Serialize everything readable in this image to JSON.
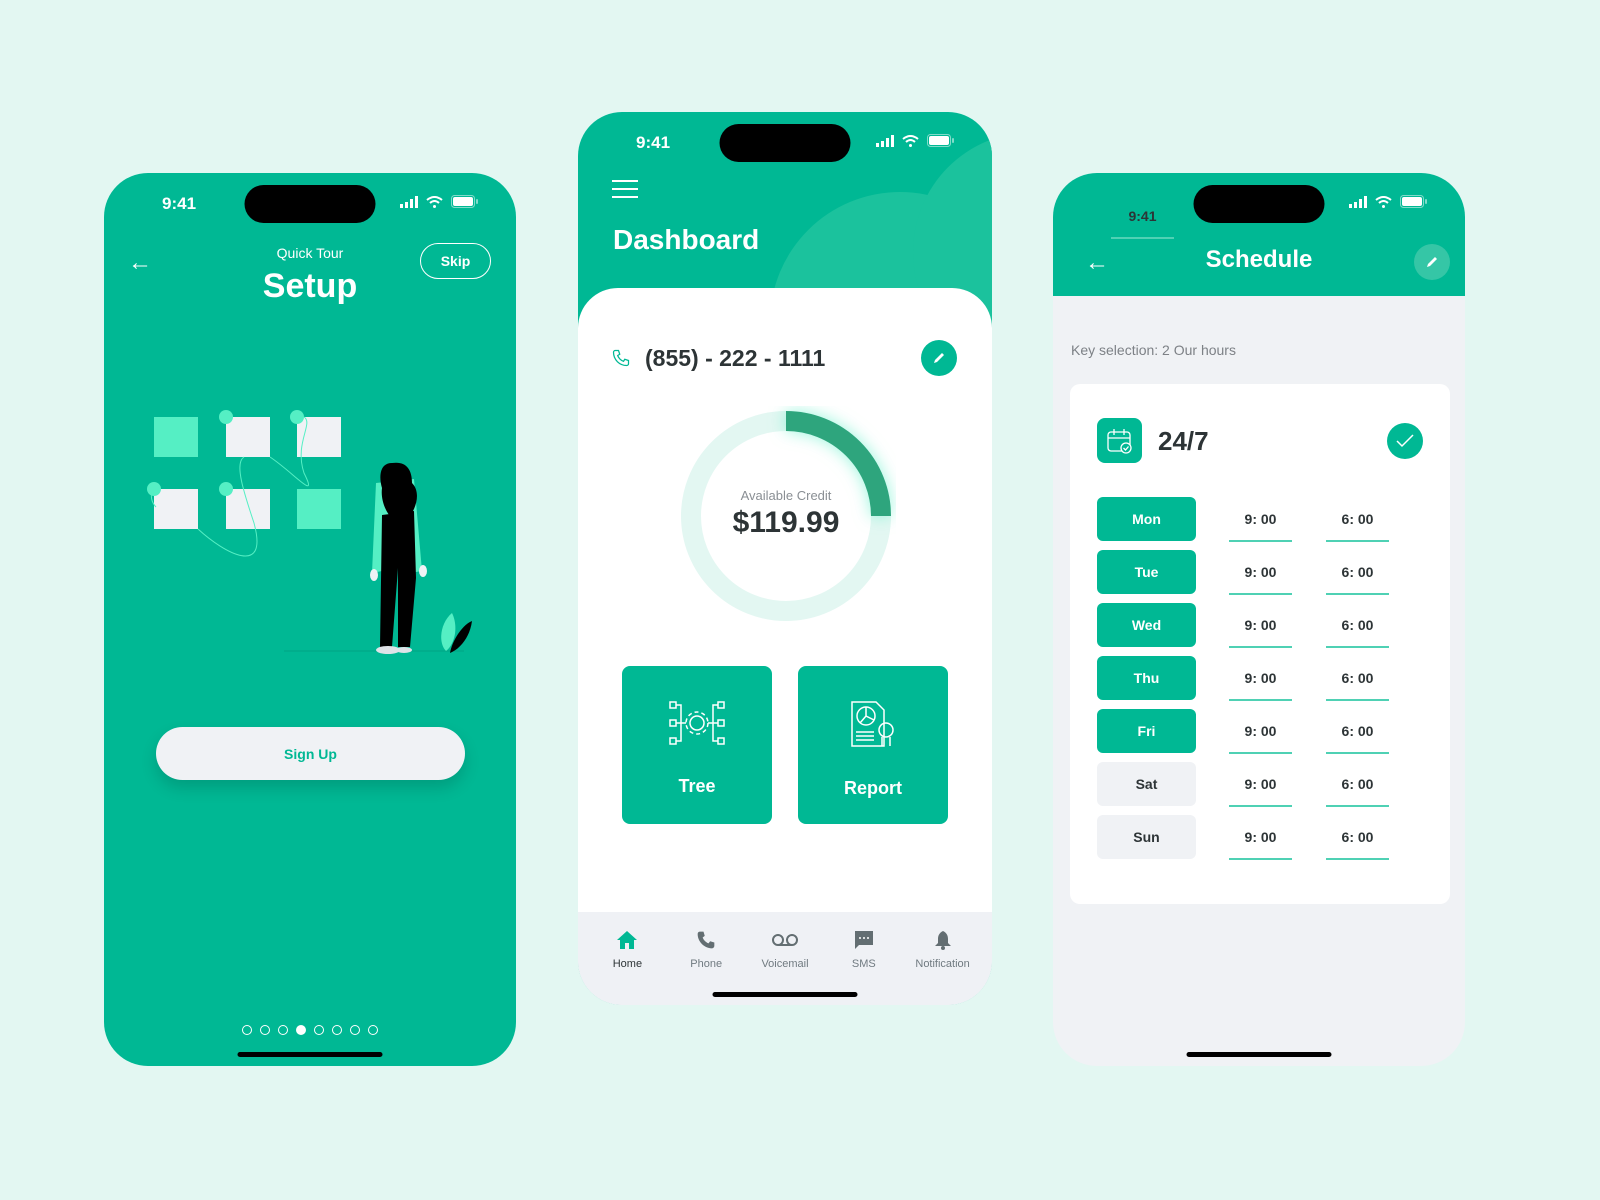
{
  "status_bar": {
    "time": "9:41"
  },
  "setup_screen": {
    "subtitle": "Quick Tour",
    "title": "Setup",
    "skip_label": "Skip",
    "signup_label": "Sign Up",
    "pagination": {
      "total": 8,
      "active_index": 3
    }
  },
  "dashboard_screen": {
    "title": "Dashboard",
    "phone_number": "(855) - 222 - 1111",
    "credit": {
      "label": "Available Credit",
      "value": "$119.99",
      "progress_fraction": 0.25
    },
    "tiles": [
      {
        "label": "Tree",
        "icon": "tree-gear-icon"
      },
      {
        "label": "Report",
        "icon": "report-icon"
      }
    ],
    "nav": [
      {
        "label": "Home",
        "icon": "home-icon",
        "active": true
      },
      {
        "label": "Phone",
        "icon": "phone-icon",
        "active": false
      },
      {
        "label": "Voicemail",
        "icon": "voicemail-icon",
        "active": false
      },
      {
        "label": "SMS",
        "icon": "sms-icon",
        "active": false
      },
      {
        "label": "Notification",
        "icon": "bell-icon",
        "active": false
      }
    ]
  },
  "schedule_screen": {
    "title": "Schedule",
    "key_selection": "Key selection: 2 Our hours",
    "mode_label": "24/7",
    "days": [
      {
        "day": "Mon",
        "start": "9: 00",
        "end": "6: 00",
        "enabled": true
      },
      {
        "day": "Tue",
        "start": "9: 00",
        "end": "6: 00",
        "enabled": true
      },
      {
        "day": "Wed",
        "start": "9: 00",
        "end": "6: 00",
        "enabled": true
      },
      {
        "day": "Thu",
        "start": "9: 00",
        "end": "6: 00",
        "enabled": true
      },
      {
        "day": "Fri",
        "start": "9: 00",
        "end": "6: 00",
        "enabled": true
      },
      {
        "day": "Sat",
        "start": "9: 00",
        "end": "6: 00",
        "enabled": false
      },
      {
        "day": "Sun",
        "start": "9: 00",
        "end": "6: 00",
        "enabled": false
      }
    ]
  },
  "colors": {
    "brand": "#00b894",
    "mint": "#55efc4",
    "dark_text": "#2d3436",
    "background": "#e3f7f2"
  }
}
